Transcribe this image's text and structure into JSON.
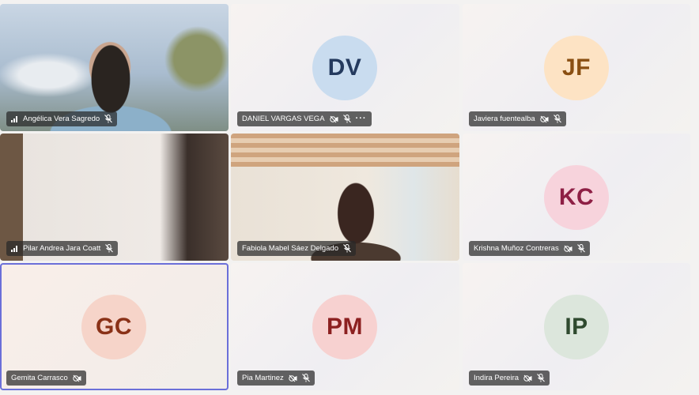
{
  "participants": [
    {
      "name": "Angélica Vera Sagredo",
      "initials": "",
      "has_video": true,
      "signal": true,
      "video_off": false,
      "muted": true,
      "more": false
    },
    {
      "name": "DANIEL VARGAS VEGA",
      "initials": "DV",
      "has_video": false,
      "signal": false,
      "video_off": true,
      "muted": true,
      "more": true,
      "avatar_bg": "#c9dcef",
      "avatar_fg": "#243a5e"
    },
    {
      "name": "Javiera fuentealba",
      "initials": "JF",
      "has_video": false,
      "signal": false,
      "video_off": true,
      "muted": true,
      "more": false,
      "avatar_bg": "#fde3c4",
      "avatar_fg": "#8a4f12"
    },
    {
      "name": "Pilar Andrea Jara Coatt",
      "initials": "",
      "has_video": true,
      "signal": true,
      "video_off": false,
      "muted": true,
      "more": false
    },
    {
      "name": "Fabiola Mabel Sáez Delgado",
      "initials": "",
      "has_video": true,
      "signal": false,
      "video_off": false,
      "muted": true,
      "more": false
    },
    {
      "name": "Krishna Muñoz Contreras",
      "initials": "KC",
      "has_video": false,
      "signal": false,
      "video_off": true,
      "muted": true,
      "more": false,
      "avatar_bg": "#f7d3dc",
      "avatar_fg": "#8e1f45"
    },
    {
      "name": "Gemita Carrasco",
      "initials": "GC",
      "has_video": false,
      "signal": false,
      "video_off": true,
      "muted": false,
      "more": false,
      "active": true,
      "avatar_bg": "#f6d4c9",
      "avatar_fg": "#8a3117"
    },
    {
      "name": "Pia Martinez",
      "initials": "PM",
      "has_video": false,
      "signal": false,
      "video_off": true,
      "muted": true,
      "more": false,
      "avatar_bg": "#f7d1d0",
      "avatar_fg": "#8c2020"
    },
    {
      "name": "Indira Pereira",
      "initials": "IP",
      "has_video": false,
      "signal": false,
      "video_off": true,
      "muted": true,
      "more": false,
      "avatar_bg": "#dce6dc",
      "avatar_fg": "#2f4a2f"
    }
  ],
  "more_label": "···",
  "colors": {
    "active_border": "#6b6fd9",
    "nametag_bg": "#282828"
  }
}
